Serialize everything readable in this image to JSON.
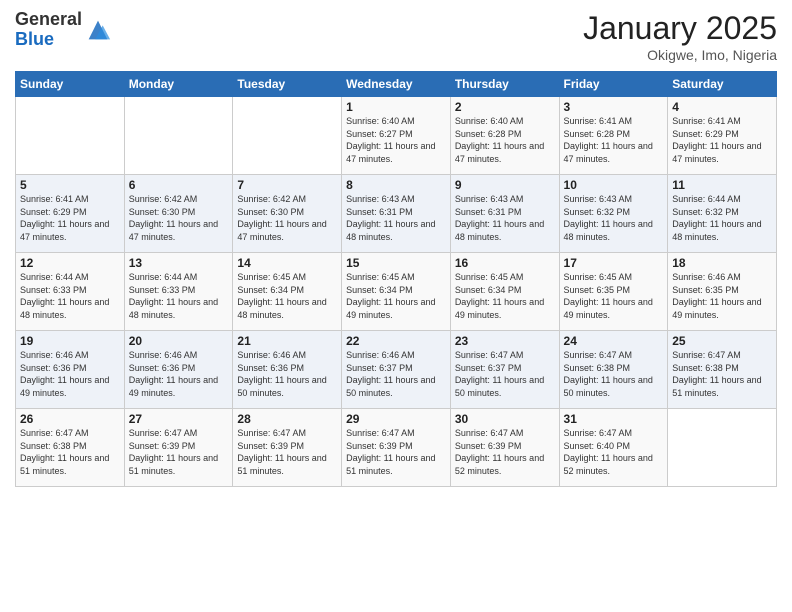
{
  "logo": {
    "general": "General",
    "blue": "Blue"
  },
  "header": {
    "month": "January 2025",
    "location": "Okigwe, Imo, Nigeria"
  },
  "days_of_week": [
    "Sunday",
    "Monday",
    "Tuesday",
    "Wednesday",
    "Thursday",
    "Friday",
    "Saturday"
  ],
  "weeks": [
    [
      {
        "day": "",
        "sunrise": "",
        "sunset": "",
        "daylight": ""
      },
      {
        "day": "",
        "sunrise": "",
        "sunset": "",
        "daylight": ""
      },
      {
        "day": "",
        "sunrise": "",
        "sunset": "",
        "daylight": ""
      },
      {
        "day": "1",
        "sunrise": "Sunrise: 6:40 AM",
        "sunset": "Sunset: 6:27 PM",
        "daylight": "Daylight: 11 hours and 47 minutes."
      },
      {
        "day": "2",
        "sunrise": "Sunrise: 6:40 AM",
        "sunset": "Sunset: 6:28 PM",
        "daylight": "Daylight: 11 hours and 47 minutes."
      },
      {
        "day": "3",
        "sunrise": "Sunrise: 6:41 AM",
        "sunset": "Sunset: 6:28 PM",
        "daylight": "Daylight: 11 hours and 47 minutes."
      },
      {
        "day": "4",
        "sunrise": "Sunrise: 6:41 AM",
        "sunset": "Sunset: 6:29 PM",
        "daylight": "Daylight: 11 hours and 47 minutes."
      }
    ],
    [
      {
        "day": "5",
        "sunrise": "Sunrise: 6:41 AM",
        "sunset": "Sunset: 6:29 PM",
        "daylight": "Daylight: 11 hours and 47 minutes."
      },
      {
        "day": "6",
        "sunrise": "Sunrise: 6:42 AM",
        "sunset": "Sunset: 6:30 PM",
        "daylight": "Daylight: 11 hours and 47 minutes."
      },
      {
        "day": "7",
        "sunrise": "Sunrise: 6:42 AM",
        "sunset": "Sunset: 6:30 PM",
        "daylight": "Daylight: 11 hours and 47 minutes."
      },
      {
        "day": "8",
        "sunrise": "Sunrise: 6:43 AM",
        "sunset": "Sunset: 6:31 PM",
        "daylight": "Daylight: 11 hours and 48 minutes."
      },
      {
        "day": "9",
        "sunrise": "Sunrise: 6:43 AM",
        "sunset": "Sunset: 6:31 PM",
        "daylight": "Daylight: 11 hours and 48 minutes."
      },
      {
        "day": "10",
        "sunrise": "Sunrise: 6:43 AM",
        "sunset": "Sunset: 6:32 PM",
        "daylight": "Daylight: 11 hours and 48 minutes."
      },
      {
        "day": "11",
        "sunrise": "Sunrise: 6:44 AM",
        "sunset": "Sunset: 6:32 PM",
        "daylight": "Daylight: 11 hours and 48 minutes."
      }
    ],
    [
      {
        "day": "12",
        "sunrise": "Sunrise: 6:44 AM",
        "sunset": "Sunset: 6:33 PM",
        "daylight": "Daylight: 11 hours and 48 minutes."
      },
      {
        "day": "13",
        "sunrise": "Sunrise: 6:44 AM",
        "sunset": "Sunset: 6:33 PM",
        "daylight": "Daylight: 11 hours and 48 minutes."
      },
      {
        "day": "14",
        "sunrise": "Sunrise: 6:45 AM",
        "sunset": "Sunset: 6:34 PM",
        "daylight": "Daylight: 11 hours and 48 minutes."
      },
      {
        "day": "15",
        "sunrise": "Sunrise: 6:45 AM",
        "sunset": "Sunset: 6:34 PM",
        "daylight": "Daylight: 11 hours and 49 minutes."
      },
      {
        "day": "16",
        "sunrise": "Sunrise: 6:45 AM",
        "sunset": "Sunset: 6:34 PM",
        "daylight": "Daylight: 11 hours and 49 minutes."
      },
      {
        "day": "17",
        "sunrise": "Sunrise: 6:45 AM",
        "sunset": "Sunset: 6:35 PM",
        "daylight": "Daylight: 11 hours and 49 minutes."
      },
      {
        "day": "18",
        "sunrise": "Sunrise: 6:46 AM",
        "sunset": "Sunset: 6:35 PM",
        "daylight": "Daylight: 11 hours and 49 minutes."
      }
    ],
    [
      {
        "day": "19",
        "sunrise": "Sunrise: 6:46 AM",
        "sunset": "Sunset: 6:36 PM",
        "daylight": "Daylight: 11 hours and 49 minutes."
      },
      {
        "day": "20",
        "sunrise": "Sunrise: 6:46 AM",
        "sunset": "Sunset: 6:36 PM",
        "daylight": "Daylight: 11 hours and 49 minutes."
      },
      {
        "day": "21",
        "sunrise": "Sunrise: 6:46 AM",
        "sunset": "Sunset: 6:36 PM",
        "daylight": "Daylight: 11 hours and 50 minutes."
      },
      {
        "day": "22",
        "sunrise": "Sunrise: 6:46 AM",
        "sunset": "Sunset: 6:37 PM",
        "daylight": "Daylight: 11 hours and 50 minutes."
      },
      {
        "day": "23",
        "sunrise": "Sunrise: 6:47 AM",
        "sunset": "Sunset: 6:37 PM",
        "daylight": "Daylight: 11 hours and 50 minutes."
      },
      {
        "day": "24",
        "sunrise": "Sunrise: 6:47 AM",
        "sunset": "Sunset: 6:38 PM",
        "daylight": "Daylight: 11 hours and 50 minutes."
      },
      {
        "day": "25",
        "sunrise": "Sunrise: 6:47 AM",
        "sunset": "Sunset: 6:38 PM",
        "daylight": "Daylight: 11 hours and 51 minutes."
      }
    ],
    [
      {
        "day": "26",
        "sunrise": "Sunrise: 6:47 AM",
        "sunset": "Sunset: 6:38 PM",
        "daylight": "Daylight: 11 hours and 51 minutes."
      },
      {
        "day": "27",
        "sunrise": "Sunrise: 6:47 AM",
        "sunset": "Sunset: 6:39 PM",
        "daylight": "Daylight: 11 hours and 51 minutes."
      },
      {
        "day": "28",
        "sunrise": "Sunrise: 6:47 AM",
        "sunset": "Sunset: 6:39 PM",
        "daylight": "Daylight: 11 hours and 51 minutes."
      },
      {
        "day": "29",
        "sunrise": "Sunrise: 6:47 AM",
        "sunset": "Sunset: 6:39 PM",
        "daylight": "Daylight: 11 hours and 51 minutes."
      },
      {
        "day": "30",
        "sunrise": "Sunrise: 6:47 AM",
        "sunset": "Sunset: 6:39 PM",
        "daylight": "Daylight: 11 hours and 52 minutes."
      },
      {
        "day": "31",
        "sunrise": "Sunrise: 6:47 AM",
        "sunset": "Sunset: 6:40 PM",
        "daylight": "Daylight: 11 hours and 52 minutes."
      },
      {
        "day": "",
        "sunrise": "",
        "sunset": "",
        "daylight": ""
      }
    ]
  ]
}
